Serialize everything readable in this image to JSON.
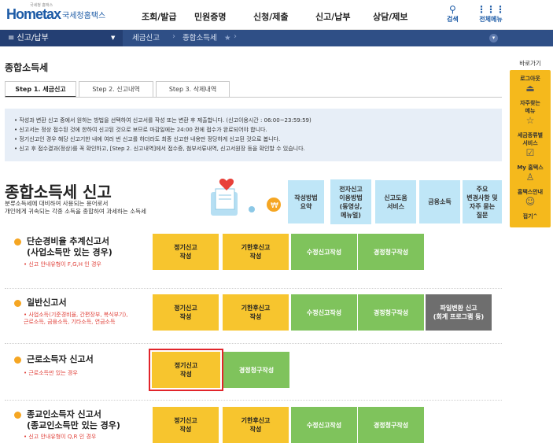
{
  "header": {
    "logo_home": "Hometax",
    "logo_sub": "국세청홈택스",
    "logo_tiny": "국세청 홈택스",
    "menu": [
      "조회/발급",
      "민원증명",
      "신청/제출",
      "신고/납부",
      "상담/제보"
    ],
    "search_label": "검색",
    "allmenu_label": "전체메뉴"
  },
  "nav": {
    "menu_label": "≡  신고/납부",
    "crumb1": "세금신고",
    "crumb2": "종합소득세"
  },
  "sidebar": {
    "title": "바로가기",
    "items": [
      {
        "label": "로그아웃",
        "icon": "logout-icon"
      },
      {
        "label": "자주찾는\n메뉴",
        "icon": "star-icon"
      },
      {
        "label": "세금종류별\n서비스",
        "icon": "check-icon"
      },
      {
        "label": "My 홈택스",
        "icon": "user-icon"
      },
      {
        "label": "홈택스안내",
        "icon": "guide-icon"
      },
      {
        "label": "접기^",
        "icon": ""
      }
    ]
  },
  "page": {
    "title": "종합소득세",
    "tabs": [
      "Step 1. 세금신고",
      "Step 2. 신고내역",
      "Step 3. 삭제내역"
    ],
    "notice": [
      "• 작성과 변환 신고 중에서 원하는 방법을 선택하여 신고서를 작성 또는 변환 후 제출합니다. (신고이용시간 : 06:00~23:59:59)",
      "• 신고서는 정상 접수된 것에 한하여 신고된 것으로 보므로 마감일에는 24:00 전에 접수가 완료되어야 합니다.",
      "• 정기신고인 경우 해당 신고기한 내에 여러 번 신고를 하더라도 최종 신고한 내용만 정당하게 신고된 것으로 봅니다.",
      "• 신고 후 접수결과(정상)를 꼭 확인하고, [Step 2. 신고내역]에서 접수증, 첨부서류내역, 신고서원장 등을 확인할 수 있습니다."
    ],
    "hero_title": "종합소득세 신고",
    "hero_sub1": "분류소득세에 대비하여 사용되는 용어로서",
    "hero_sub2": "개인에게 귀속되는 각종 소득을 종합하여 과세하는 소득세",
    "quick": [
      "작성방법\n요약",
      "전자신고\n이용방법\n(동영상,\n메뉴얼)",
      "신고도움\n서비스",
      "금융소득",
      "주요\n변경사항 및\n자주 묻는\n질문"
    ]
  },
  "sections": [
    {
      "title": "단순경비율 추계신고서\n(사업소득만 있는 경우)",
      "note": "• 신고 안내유형이 F,G,H 인 경우",
      "buttons": [
        "정기신고\n작성",
        "기한후신고\n작성",
        "수정신고작성",
        "경정청구작성"
      ]
    },
    {
      "title": "일반신고서",
      "note": "• 사업소득(기준경비율, 간편장부, 복식부기),\n근로소득, 금융소득, 기타소득, 연금소득",
      "buttons": [
        "정기신고\n작성",
        "기한후신고\n작성",
        "수정신고작성",
        "경정청구작성",
        "파일변환 신고\n(회계 프로그램 등)"
      ]
    },
    {
      "title": "근로소득자 신고서",
      "note": "• 근로소득만 있는 경우",
      "buttons": [
        "정기신고\n작성",
        "경정청구작성"
      ]
    },
    {
      "title": "종교인소득자 신고서\n(종교인소득만 있는 경우)",
      "note": "• 신고 안내유형이 Q,R 인 경우",
      "buttons": [
        "정기신고\n작성",
        "기한후신고\n작성",
        "수정신고작성",
        "경정청구작성"
      ]
    }
  ],
  "colors": {
    "navy": "#2f4f86",
    "yellow": "#f7c52e",
    "green": "#7fc35c",
    "highlight": "#e1252b"
  }
}
